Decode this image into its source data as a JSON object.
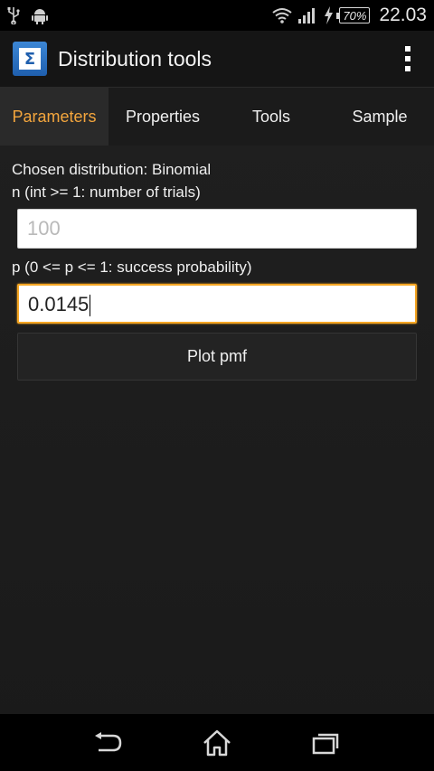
{
  "status_bar": {
    "icons": [
      "usb-icon",
      "android-debug-icon",
      "wifi-icon",
      "signal-icon",
      "charging-icon"
    ],
    "battery": "70%",
    "time": "22.03"
  },
  "action_bar": {
    "app_icon": "sigma-icon",
    "title": "Distribution tools",
    "overflow_icon": "overflow-menu-icon"
  },
  "tabs": [
    {
      "label": "Parameters",
      "active": true
    },
    {
      "label": "Properties",
      "active": false
    },
    {
      "label": "Tools",
      "active": false
    },
    {
      "label": "Sample",
      "active": false
    }
  ],
  "form": {
    "distribution_label": "Chosen distribution: Binomial",
    "n_label": "n (int >= 1: number of trials)",
    "n_placeholder": "100",
    "n_value": "",
    "p_label": "p (0 <= p <= 1: success probability)",
    "p_value": "0.0145",
    "plot_button": "Plot pmf"
  },
  "nav_bar": {
    "back": "back-icon",
    "home": "home-icon",
    "recents": "recents-icon"
  },
  "colors": {
    "accent": "#f4a63d",
    "focus_border": "#f5a623",
    "app_icon_blue": "#2a6fbf"
  }
}
